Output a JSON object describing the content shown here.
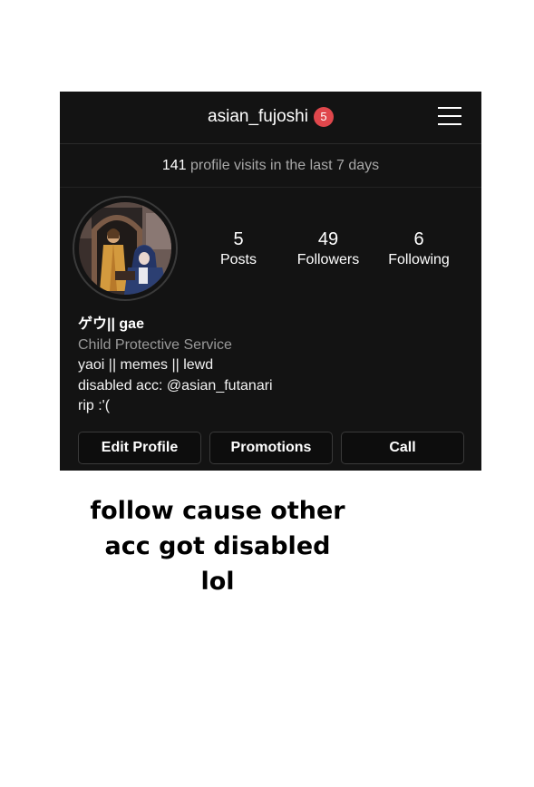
{
  "header": {
    "username": "asian_fujoshi",
    "notification_count": "5",
    "menu_icon": "hamburger-menu-icon"
  },
  "insights": {
    "count": "141",
    "text": "profile visits in the last 7 days"
  },
  "profile": {
    "avatar": "profile-picture"
  },
  "stats": {
    "posts": {
      "value": "5",
      "label": "Posts"
    },
    "followers": {
      "value": "49",
      "label": "Followers"
    },
    "following": {
      "value": "6",
      "label": "Following"
    }
  },
  "bio": {
    "display_name": "ゲウ|| gae",
    "category": "Child Protective Service",
    "lines": [
      "yaoi || memes || lewd",
      "disabled acc: @asian_futanari",
      "rip :'("
    ]
  },
  "buttons": {
    "edit_profile": "Edit Profile",
    "promotions": "Promotions",
    "call": "Call"
  },
  "caption": {
    "lines": [
      "follow cause other",
      "acc got disabled",
      "lol"
    ]
  },
  "colors": {
    "background": "#131313",
    "badge": "#e0474c",
    "muted": "#a8a8a8"
  }
}
